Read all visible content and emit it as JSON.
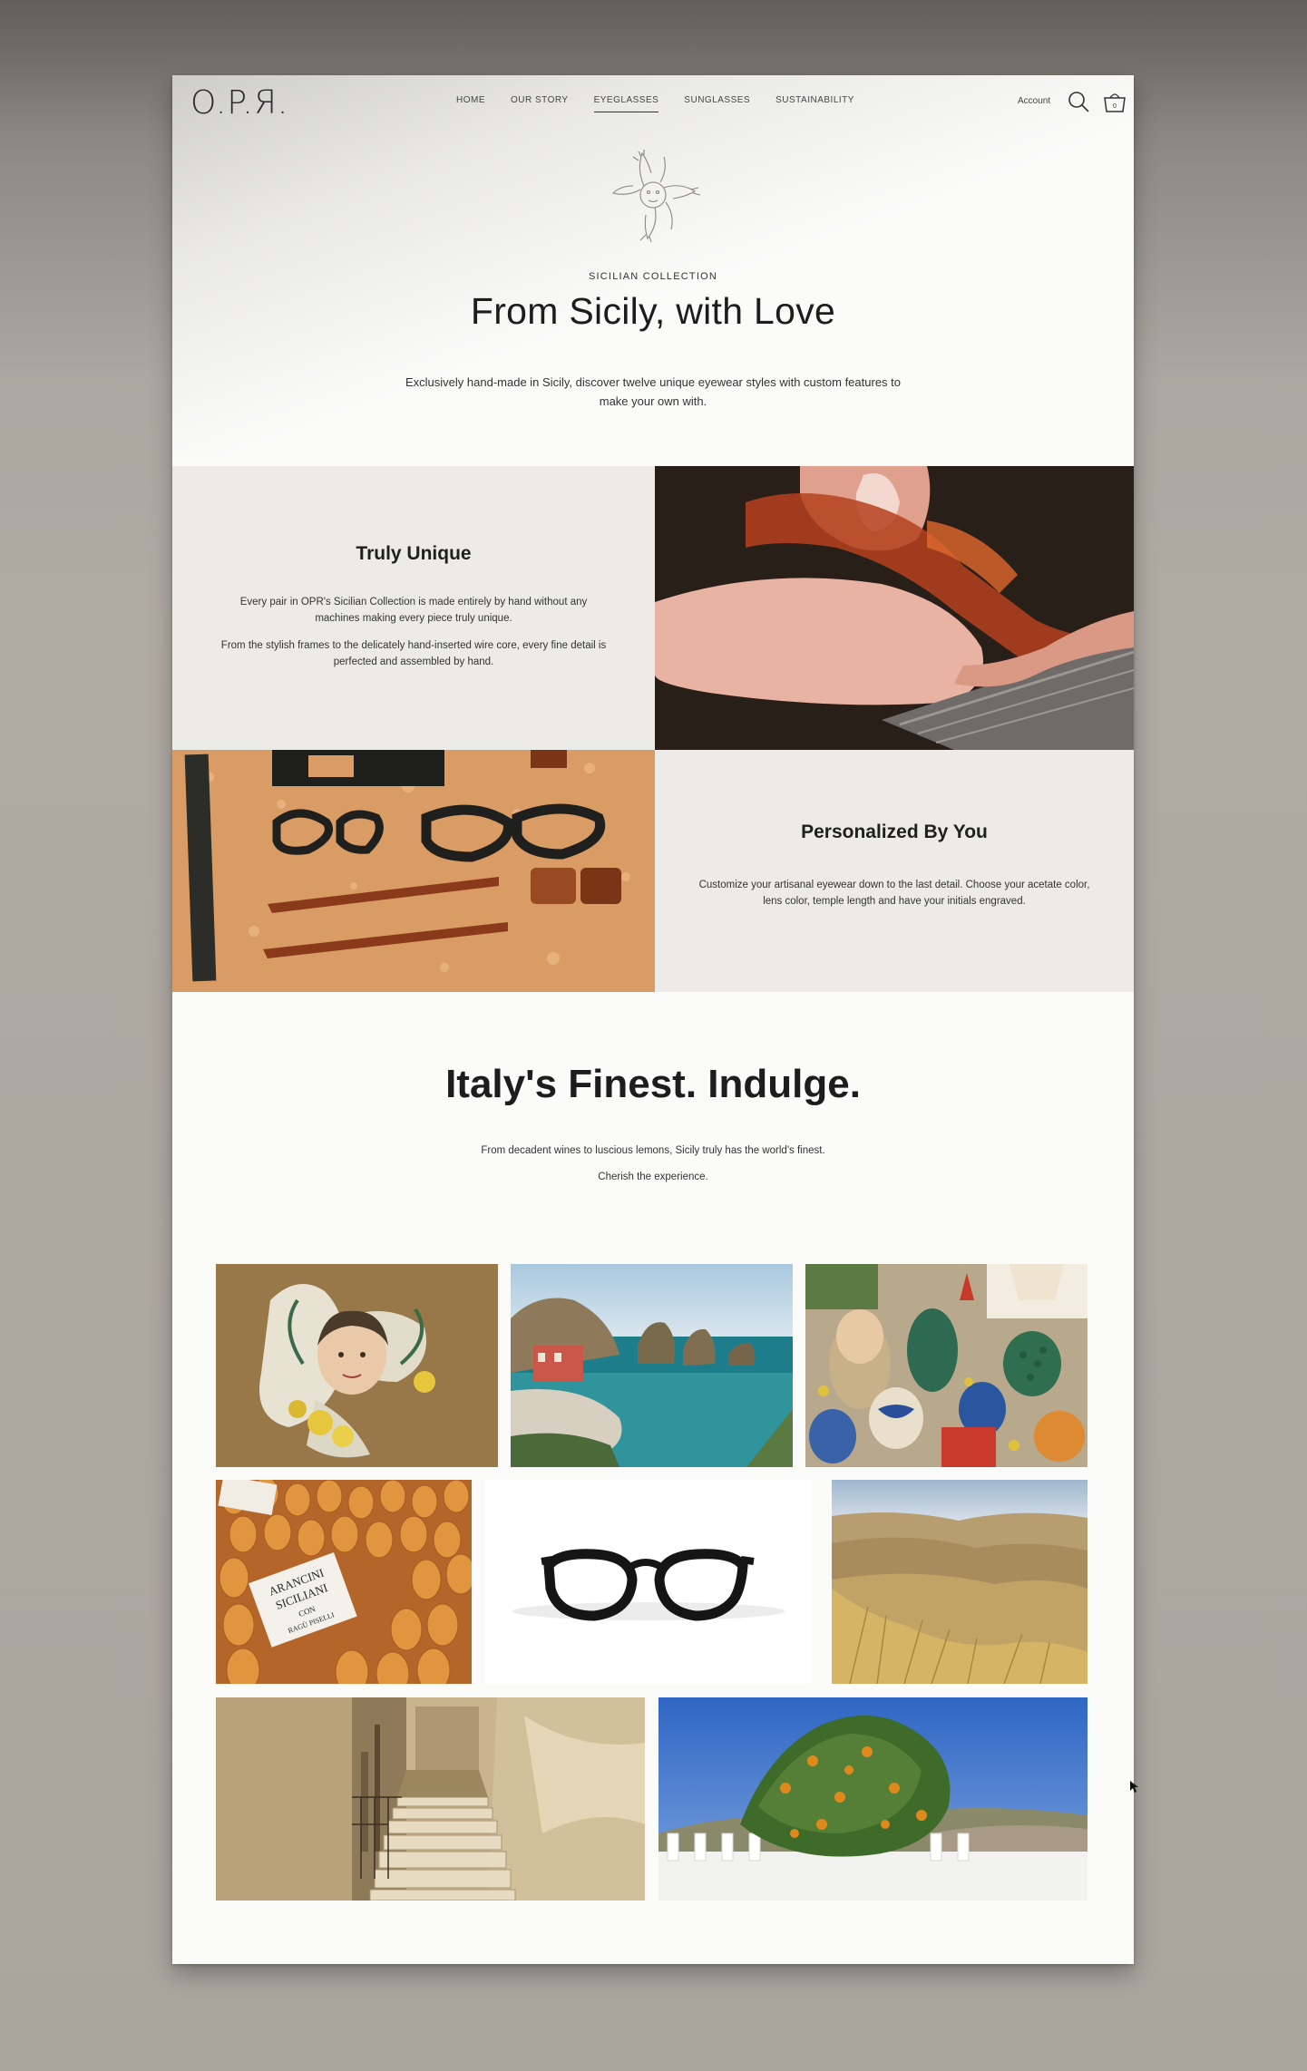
{
  "brand": {
    "logo_text": "O.P.Я."
  },
  "nav": {
    "items": [
      {
        "label": "HOME"
      },
      {
        "label": "OUR STORY"
      },
      {
        "label": "EYEGLASSES",
        "active": true
      },
      {
        "label": "SUNGLASSES"
      },
      {
        "label": "SUSTAINABILITY"
      }
    ],
    "account_label": "Account",
    "cart_count": "0"
  },
  "hero": {
    "eyebrow": "SICILIAN COLLECTION",
    "title": "From Sicily, with Love",
    "text": "Exclusively hand-made in Sicily, discover twelve unique eyewear styles with custom features to make your own with."
  },
  "features": {
    "unique": {
      "title": "Truly Unique",
      "text1": "Every pair in OPR's Sicilian Collection is made entirely by hand without any machines making every piece truly unique.",
      "text2": "From the stylish frames to the delicately hand-inserted wire core, every fine detail is perfected and assembled by hand."
    },
    "personalized": {
      "title": "Personalized By You",
      "text": "Customize your artisanal eyewear down to the last detail. Choose your acetate color, lens color, temple length and have your initials engraved."
    }
  },
  "indulge": {
    "title": "Italy's Finest. Indulge.",
    "text1": "From decadent wines to luscious lemons, Sicily truly has the world's finest.",
    "text2": "Cherish the experience."
  },
  "gallery": {
    "arancini_sign": [
      "ARANCINI",
      "SICILIANI",
      "CON",
      "RAGÙ PISELLI"
    ]
  },
  "colors": {
    "accent_text": "#1d1d1d",
    "panel_bg": "#ecebe8",
    "page_bg": "#fbfbfa"
  }
}
